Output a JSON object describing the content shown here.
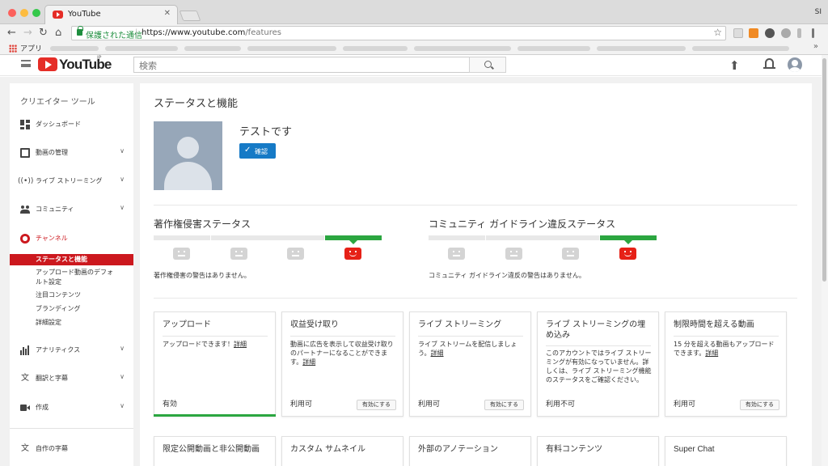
{
  "browser": {
    "tab_title": "YouTube",
    "tab_close": "✕",
    "profile_initials": "SI",
    "secure_label": "保護された通信",
    "url_host": "https://www.youtube.com",
    "url_path": "/features",
    "bookmarks_apps": "アプリ",
    "bookmarks_more": "»"
  },
  "header": {
    "logo_text": "YouTube",
    "logo_region": "JP",
    "search_placeholder": "検索"
  },
  "sidebar": {
    "title": "クリエイター ツール",
    "items": [
      {
        "label": "ダッシュボード"
      },
      {
        "label": "動画の管理"
      },
      {
        "label": "ライブ ストリーミング"
      },
      {
        "label": "コミュニティ"
      },
      {
        "label": "チャンネル"
      },
      {
        "label": "アナリティクス"
      },
      {
        "label": "翻訳と字幕"
      },
      {
        "label": "作成"
      },
      {
        "label": "自作の字幕"
      }
    ],
    "channel_subitems": [
      {
        "label": "ステータスと機能"
      },
      {
        "label": "アップロード動画のデフォルト設定"
      },
      {
        "label": "注目コンテンツ"
      },
      {
        "label": "ブランディング"
      },
      {
        "label": "詳細設定"
      }
    ]
  },
  "main": {
    "title": "ステータスと機能",
    "channel_name": "テストです",
    "verify_button": "確認",
    "copyright": {
      "title": "著作権侵害ステータス",
      "message": "著作権侵害の警告はありません。",
      "level": 4,
      "levels_total": 4
    },
    "community": {
      "title": "コミュニティ ガイドライン違反ステータス",
      "message": "コミュニティ ガイドライン違反の警告はありません。",
      "level": 4,
      "levels_total": 4
    },
    "features": [
      {
        "title": "アップロード",
        "desc": "アップロードできます！",
        "link": "詳細",
        "status": "有効",
        "button": ""
      },
      {
        "title": "収益受け取り",
        "desc": "動画に広告を表示して収益受け取りのパートナーになることができます。",
        "link": "詳細",
        "status": "利用可",
        "button": "有効にする"
      },
      {
        "title": "ライブ ストリーミング",
        "desc": "ライブ ストリームを配信しましょう。",
        "link": "詳細",
        "status": "利用可",
        "button": "有効にする"
      },
      {
        "title": "ライブ ストリーミングの埋め込み",
        "desc": "このアカウントではライブ ストリーミングが有効になっていません。詳しくは、ライブ ストリーミング機能のステータスをご確認ください。",
        "link": "",
        "status": "利用不可",
        "button": ""
      },
      {
        "title": "制限時間を超える動画",
        "desc": "15 分を超える動画もアップロードできます。",
        "link": "詳細",
        "status": "利用可",
        "button": "有効にする"
      }
    ],
    "features_row2": [
      {
        "title": "限定公開動画と非公開動画"
      },
      {
        "title": "カスタム サムネイル"
      },
      {
        "title": "外部のアノテーション"
      },
      {
        "title": "有料コンテンツ"
      },
      {
        "title": "Super Chat"
      }
    ]
  },
  "colors": {
    "yt_red": "#e52d27",
    "active_red": "#cc181e",
    "good_green": "#2ba640",
    "button_blue": "#167ac6"
  }
}
